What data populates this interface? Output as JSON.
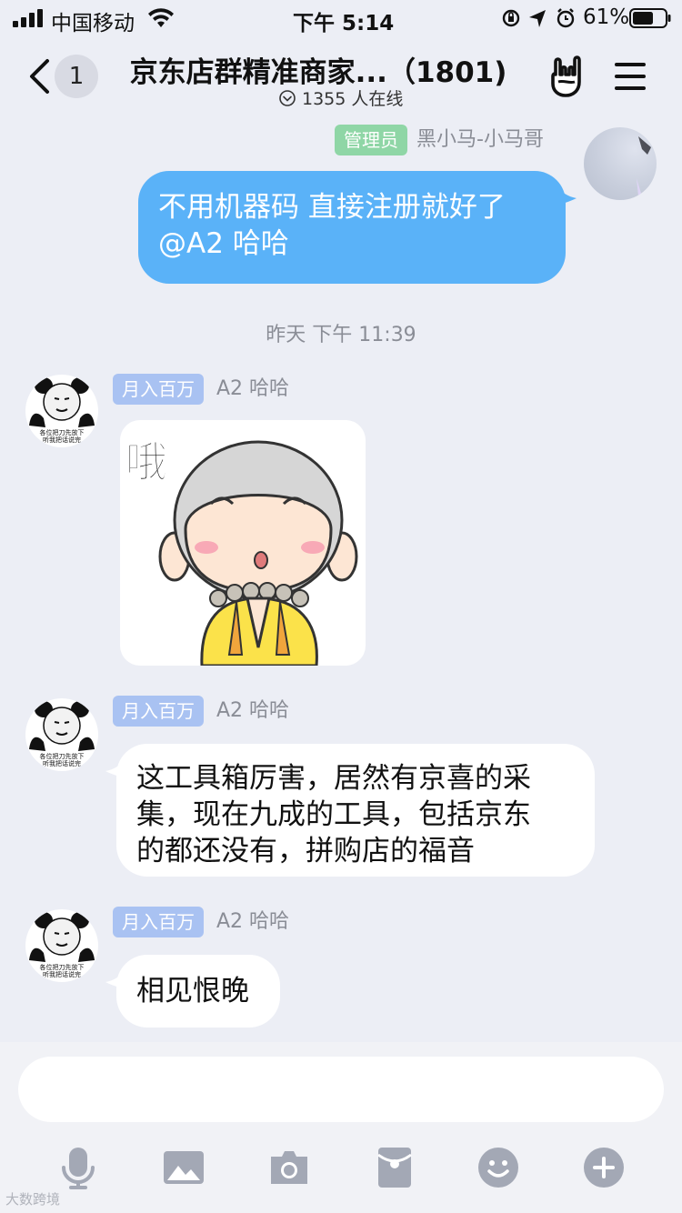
{
  "status_bar": {
    "carrier": "中国移动",
    "time": "下午 5:14",
    "battery": "61%"
  },
  "header": {
    "unread_count": "1",
    "title": "京东店群精准商家...（1801)",
    "online": "1355 人在线"
  },
  "messages": [
    {
      "direction": "outgoing",
      "role_tag": "管理员",
      "sender": "黑小马-小马哥",
      "lines": [
        "不用机器码 直接注册就好了",
        "@A2 哈哈"
      ]
    },
    {
      "type": "timestamp",
      "text": "昨天 下午 11:39"
    },
    {
      "direction": "incoming",
      "role_tag": "月入百万",
      "sender": "A2 哈哈",
      "avatar_caption": [
        "各位把刀先放下",
        "听我把话说完"
      ],
      "sticker_text": "哦"
    },
    {
      "direction": "incoming",
      "role_tag": "月入百万",
      "sender": "A2 哈哈",
      "avatar_caption": [
        "各位把刀先放下",
        "听我把话说完"
      ],
      "lines": [
        "这工具箱厉害，居然有京喜的采",
        "集，现在九成的工具，包括京东",
        "的都还没有，拼购店的福音"
      ]
    },
    {
      "direction": "incoming",
      "role_tag": "月入百万",
      "sender": "A2 哈哈",
      "avatar_caption": [
        "各位把刀先放下",
        "听我把话说完"
      ],
      "lines": [
        "相见恨晚"
      ]
    }
  ],
  "input": {
    "placeholder": ""
  },
  "toolbar": [
    "microphone-icon",
    "image-icon",
    "camera-icon",
    "red-packet-icon",
    "emoji-icon",
    "plus-icon"
  ],
  "watermark": "大数跨境",
  "colors": {
    "outgoing_bubble": "#5ab2f8",
    "incoming_bubble": "#ffffff",
    "background": "#eceef5",
    "admin_tag": "#8fd6a6",
    "rank_tag": "#a9c2f2",
    "toolbar_icon": "#a3a8b5"
  }
}
